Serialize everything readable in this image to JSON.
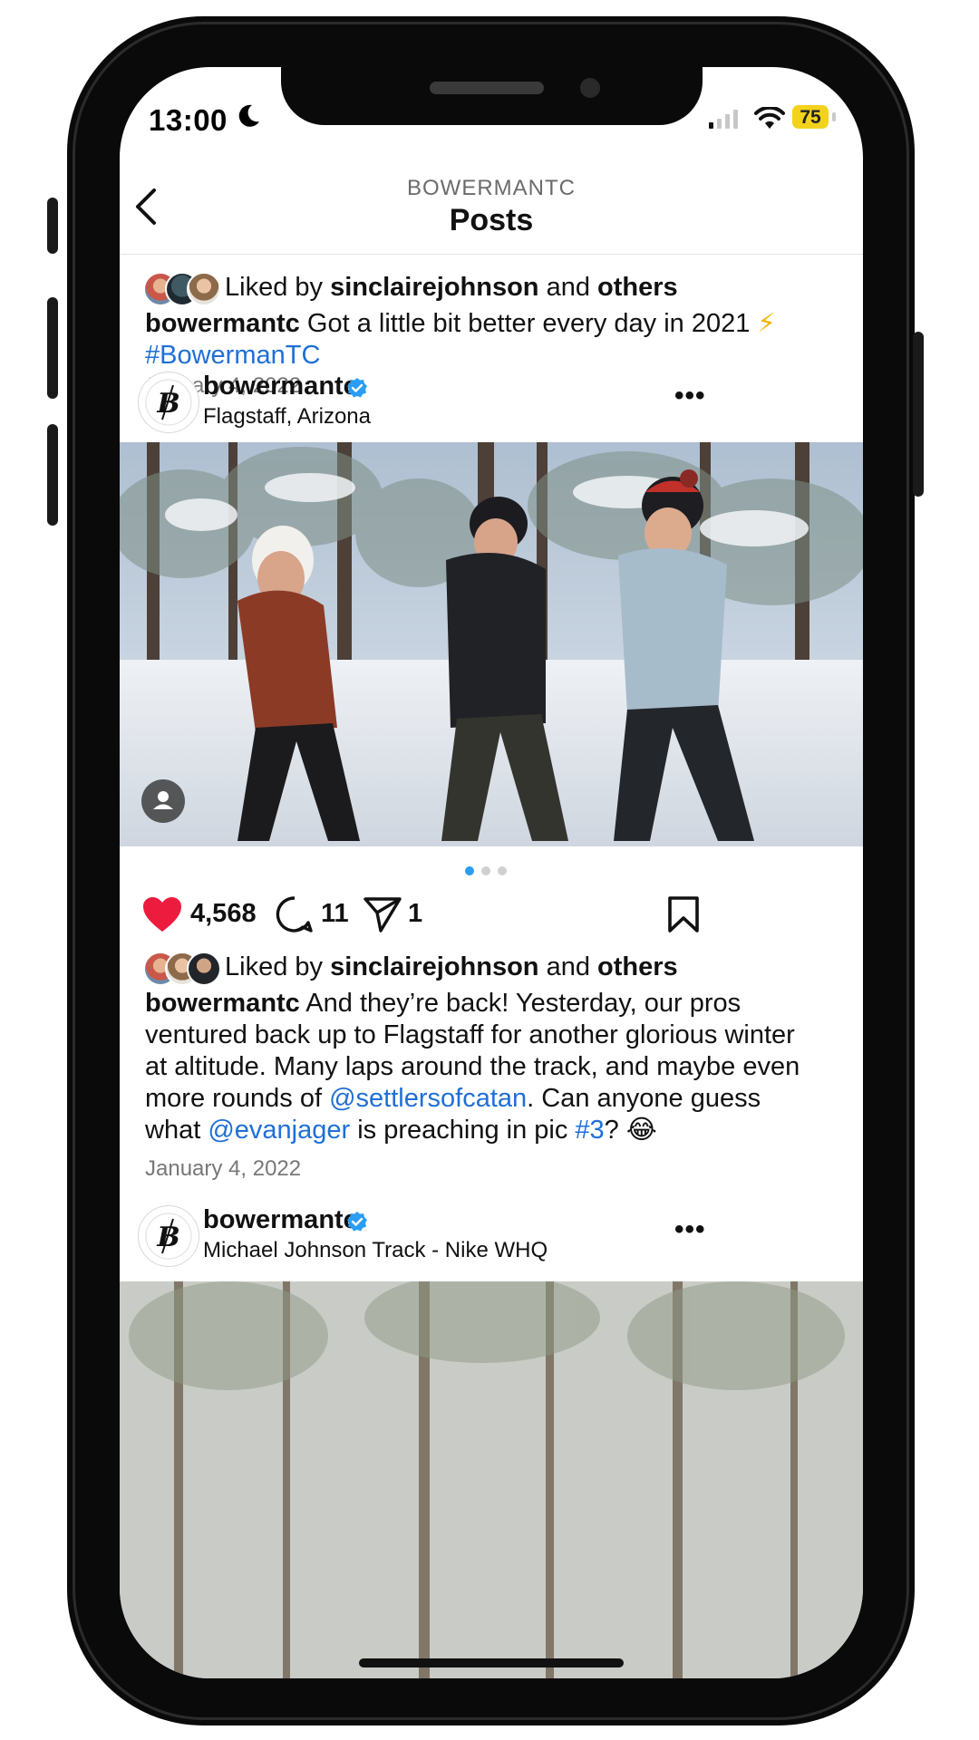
{
  "status_bar": {
    "time": "13:00",
    "battery": "75"
  },
  "header": {
    "account": "BOWERMANTC",
    "title": "Posts"
  },
  "post_top": {
    "liked_prefix": "Liked by",
    "liked_user": "sinclairejohnson",
    "liked_and": "and",
    "liked_others": "others",
    "caption_user": "bowermantc",
    "caption_text": "Got a little bit better every day in 2021",
    "caption_emoji": "⚡",
    "caption_hashtag": "#BowermanTC",
    "date": "January 4, 2022"
  },
  "post_main": {
    "username": "bowermantc",
    "location": "Flagstaff, Arizona",
    "likes": "4,568",
    "comments": "11",
    "shares": "1",
    "liked_prefix": "Liked by",
    "liked_user": "sinclairejohnson",
    "liked_and": "and",
    "liked_others": "others",
    "caption_user": "bowermantc",
    "caption_text_1": "And they’re back! Yesterday, our pros ventured back up to Flagstaff for another glorious winter at altitude. Many laps around the track, and maybe even more rounds of",
    "caption_mention_1": "@settlersofcatan",
    "caption_text_2": ". Can anyone guess what",
    "caption_mention_2": "@evanjager",
    "caption_text_3": "is preaching in pic",
    "caption_hashtag": "#3",
    "caption_text_4": "?",
    "caption_emoji": "😂",
    "date": "January 4, 2022"
  },
  "post_next": {
    "username": "bowermantc",
    "location": "Michael Johnson Track - Nike WHQ"
  },
  "icons": {
    "heart": "heart-filled-icon",
    "comment": "comment-icon",
    "share": "paper-plane-icon",
    "bookmark": "bookmark-icon",
    "verified": "verified-badge-icon",
    "more": "more-dots-icon",
    "back": "chevron-left-icon",
    "user_tag": "user-tag-icon"
  },
  "colors": {
    "heart": "#ed1c3f",
    "link": "#1f6fd6",
    "verified": "#2a9df4",
    "carousel_active": "#2a9df4",
    "battery": "#f3d21b"
  },
  "carousel": {
    "total": 3,
    "active_index": 0
  }
}
